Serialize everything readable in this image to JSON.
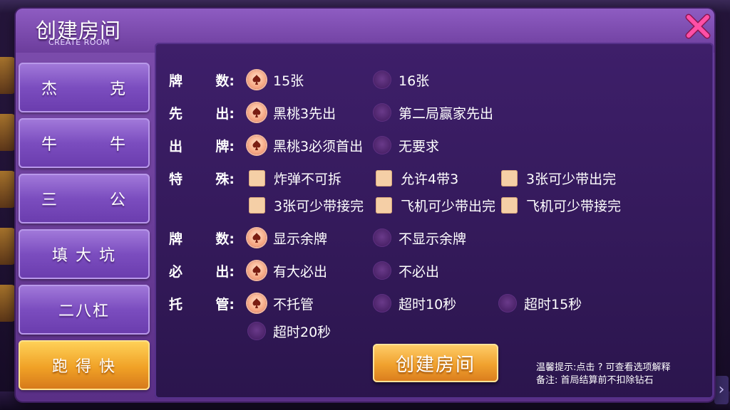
{
  "dialog": {
    "title": "创建房间",
    "subtitle": "CREATE ROOM"
  },
  "tabs": [
    {
      "label": "杰克",
      "spread": true,
      "active": false
    },
    {
      "label": "牛牛",
      "spread": true,
      "active": false
    },
    {
      "label": "三公",
      "spread": true,
      "active": false
    },
    {
      "label": "填 大 坑",
      "spread": false,
      "active": false
    },
    {
      "label": "二八杠",
      "spread": false,
      "active": false
    },
    {
      "label": "跑 得 快",
      "spread": false,
      "active": true
    }
  ],
  "rows": {
    "pai_shu_1": {
      "label": [
        "牌",
        "数:"
      ],
      "options": [
        "15张",
        "16张"
      ],
      "selected": "15张"
    },
    "xian_chu": {
      "label": [
        "先",
        "出:"
      ],
      "options": [
        "黑桃3先出",
        "第二局赢家先出"
      ],
      "selected": "黑桃3先出"
    },
    "chu_pai": {
      "label": [
        "出",
        "牌:"
      ],
      "options": [
        "黑桃3必须首出",
        "无要求"
      ],
      "selected": "黑桃3必须首出"
    },
    "te_shu": {
      "label": [
        "特",
        "殊:"
      ],
      "checkboxes": [
        "炸弹不可拆",
        "允许4带3",
        "3张可少带出完",
        "3张可少带接完",
        "飞机可少带出完",
        "飞机可少带接完"
      ]
    },
    "pai_shu_2": {
      "label": [
        "牌",
        "数:"
      ],
      "options": [
        "显示余牌",
        "不显示余牌"
      ],
      "selected": "显示余牌"
    },
    "bi_chu": {
      "label": [
        "必",
        "出:"
      ],
      "options": [
        "有大必出",
        "不必出"
      ],
      "selected": "有大必出"
    },
    "tuo_guan": {
      "label": [
        "托",
        "管:"
      ],
      "options": [
        "不托管",
        "超时10秒",
        "超时15秒",
        "超时20秒"
      ],
      "selected": "不托管"
    }
  },
  "create_button": "创建房间",
  "hints": {
    "line1": "温馨提示:点击 ?  可查看选项解释",
    "line2": "备注: 首局结算前不扣除钻石"
  },
  "colors": {
    "selected_radio": "#f7a985",
    "accent_orange": "#f0a126",
    "panel_purple": "#2b154d",
    "close_pink": "#ff3c9c"
  }
}
